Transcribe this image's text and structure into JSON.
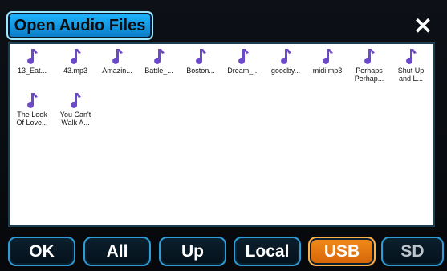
{
  "window": {
    "title": "Open Audio Files",
    "close_glyph": "✕"
  },
  "files": [
    {
      "label": "13_Eat..."
    },
    {
      "label": "43.mp3"
    },
    {
      "label": "Amazin..."
    },
    {
      "label": "Battle_..."
    },
    {
      "label": "Boston..."
    },
    {
      "label": "Dream_..."
    },
    {
      "label": "goodby..."
    },
    {
      "label": "midi.mp3"
    },
    {
      "label": "Perhaps\nPerhap..."
    },
    {
      "label": "Shut Up\nand L..."
    },
    {
      "label": "The Look\nOf Love..."
    },
    {
      "label": "You Can't\nWalk A..."
    }
  ],
  "buttons": {
    "ok": "OK",
    "all": "All",
    "up": "Up",
    "local": "Local",
    "usb": "USB",
    "sd": "SD"
  },
  "colors": {
    "accent": "#1fb7ff",
    "active": "#f08b1a",
    "icon": "#6b49c7"
  },
  "icons": {
    "file_icon": "music-note-icon",
    "close_icon": "close-icon"
  }
}
